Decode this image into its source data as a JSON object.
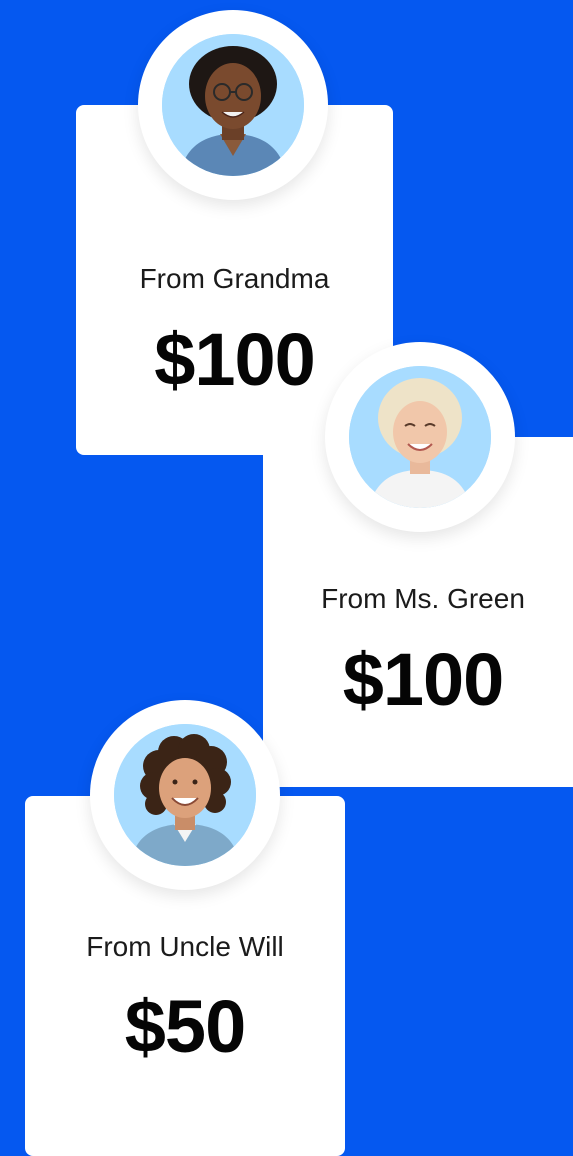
{
  "colors": {
    "background": "#0558f0",
    "card": "#ffffff",
    "avatar_backdrop": "#a8dcff"
  },
  "gifts": [
    {
      "label": "From Grandma",
      "amount": "$100",
      "avatar_icon": "grandma-avatar-icon"
    },
    {
      "label": "From Ms. Green",
      "amount": "$100",
      "avatar_icon": "ms-green-avatar-icon"
    },
    {
      "label": "From Uncle Will",
      "amount": "$50",
      "avatar_icon": "uncle-will-avatar-icon"
    }
  ]
}
